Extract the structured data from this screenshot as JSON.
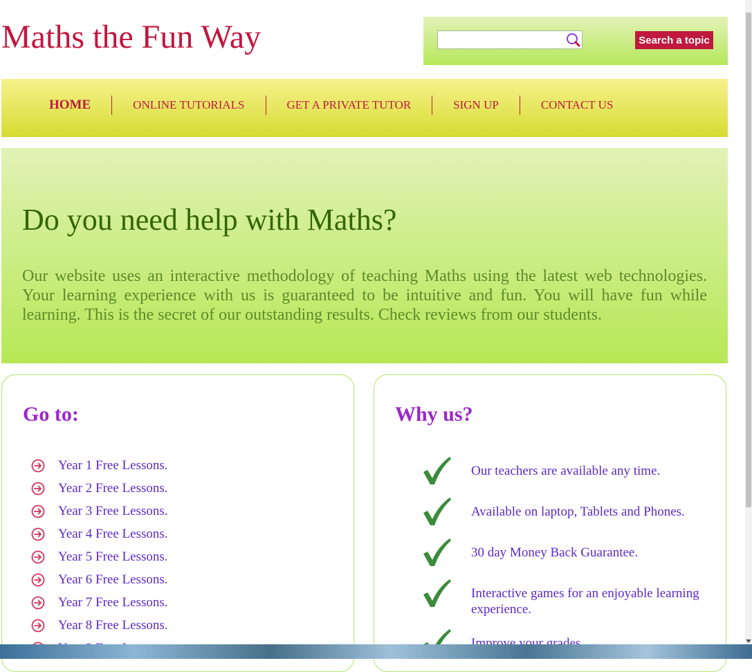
{
  "site": {
    "title": "Maths the Fun Way"
  },
  "search": {
    "placeholder": "",
    "value": "",
    "button_label": "Search a topic"
  },
  "nav": {
    "items": [
      {
        "label": "HOME",
        "active": true
      },
      {
        "label": "ONLINE TUTORIALS",
        "active": false
      },
      {
        "label": "GET A PRIVATE TUTOR",
        "active": false
      },
      {
        "label": "SIGN UP",
        "active": false
      },
      {
        "label": "CONTACT US",
        "active": false
      }
    ]
  },
  "hero": {
    "title": "Do you need help with Maths?",
    "text": "Our website uses an interactive methodology of teaching Maths using the latest web technologies. Your learning experience with us is guaranteed to be intuitive and fun. You will have fun while learning. This is the secret of our outstanding results. Check reviews from our students."
  },
  "goto": {
    "heading": "Go to:",
    "items": [
      "Year 1 Free Lessons.",
      "Year 2 Free Lessons.",
      "Year 3 Free Lessons.",
      "Year 4 Free Lessons.",
      "Year 5 Free Lessons.",
      "Year 6 Free Lessons.",
      "Year 7 Free Lessons.",
      "Year 8 Free Lessons.",
      "Year 9 Free Lessons."
    ]
  },
  "why": {
    "heading": "Why us?",
    "items": [
      "Our teachers are available any time.",
      "Available on laptop, Tablets and Phones.",
      "30 day Money Back Guarantee.",
      "Interactive games for an enjoyable learning experience.",
      "Improve your grades."
    ]
  },
  "icons": {
    "search": "search-icon",
    "lesson_bullet": "arrow-right-circle-icon",
    "why_bullet": "checkmark-icon"
  },
  "colors": {
    "brand": "#c0183e",
    "heading_purple": "#9b27c9",
    "link_blue": "#5b29c8",
    "hero_title": "#336604",
    "check_green": "#3a8b3a"
  }
}
